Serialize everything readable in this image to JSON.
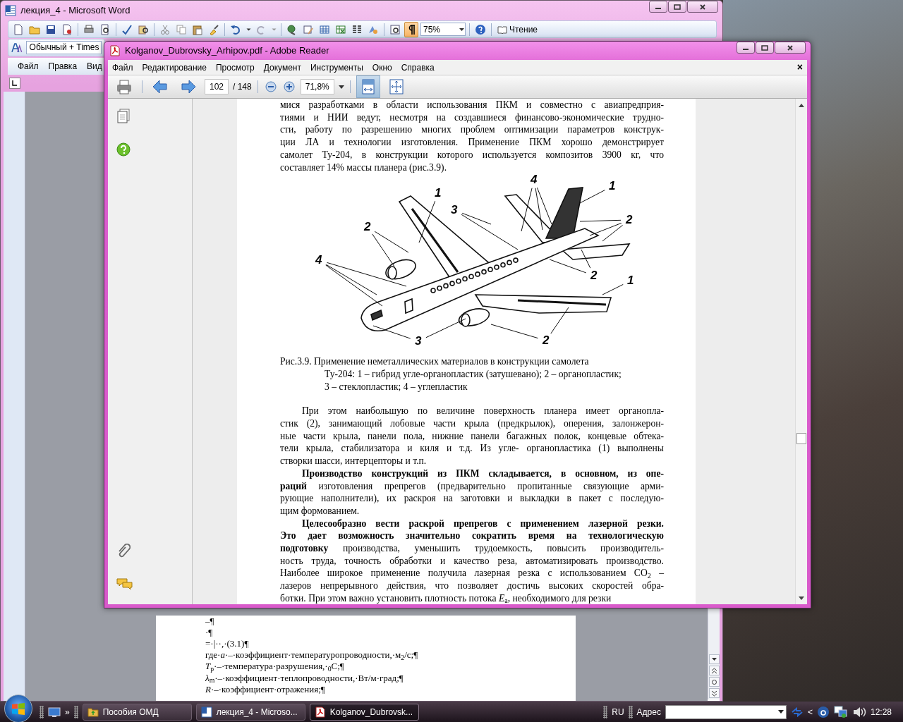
{
  "word_window": {
    "title": "лекция_4 - Microsoft Word",
    "zoom": "75%",
    "formatting_marks_on": true,
    "reading_button": "Чтение",
    "style_box": "Обычный + Times",
    "menu": [
      "Файл",
      "Правка",
      "Вид"
    ],
    "document_lines": [
      "–¶",
      "·¶",
      "=·|··,·(3.1)¶",
      "где·*a*·–·коэффициент·температуропроводности,·м$_{2}$/с;¶",
      "*T*$_{р}$·–·температура·разрушения,·$_{0}$С;¶",
      "*λ*$_{m}$·–·коэффициент·теплопроводности,·Вт/м·град;¶",
      "*R*·–·коэффициент·отражения;¶"
    ]
  },
  "reader_window": {
    "title": "Kolganov_Dubrovsky_Arhipov.pdf - Adobe Reader",
    "menu": [
      "Файл",
      "Редактирование",
      "Просмотр",
      "Документ",
      "Инструменты",
      "Окно",
      "Справка"
    ],
    "menu_close": "×",
    "page_number": "102",
    "page_total": "/ 148",
    "zoom": "71,8%",
    "view_tools": [
      {
        "kind": "fit-width",
        "selected": true
      },
      {
        "kind": "fit-page",
        "selected": false
      }
    ],
    "page": {
      "paragraphs_before": [
        {
          "kind": "continuation",
          "lines": [
            "мися разработками в области использования ПКМ и совместно с авиапредприя-",
            "тиями и НИИ ведут, несмотря на создавшиеся финансово-экономические трудно-",
            "сти, работу по разрешению многих проблем оптимизации параметров конструк-",
            "ции ЛА и технологии изготовления. Применение ПКМ хорошо демонстрирует",
            "самолет Ту-204, в конструкции которого используется композитов 3900 кг, что",
            "составляет 14% массы планера (рис.3.9)."
          ]
        }
      ],
      "figure": {
        "labels": [
          "4",
          "1",
          "3",
          "2",
          "4",
          "1",
          "2",
          "2",
          "1",
          "3",
          "2"
        ],
        "caption": [
          "Рис.3.9. Применение неметаллических материалов в конструкции самолета",
          "Ту-204: 1 – гибрид угле-органопластик (затушевано); 2 – органопластик;",
          "3 – стеклопластик; 4 – углепластик"
        ]
      },
      "paragraphs_after": [
        {
          "kind": "paragraph",
          "lines": [
            "При этом наибольшую по величине поверхность планера имеет органопла-",
            "стик (2), занимающий лобовые части крыла (предкрылок), оперения, залонжерон-",
            "ные части крыла, панели пола, нижние панели багажных полок, концевые обтека-",
            "тели крыла, стабилизатора и киля и т.д. Из угле- органопластика (1) выполнены",
            "створки шасси, интерцепторы и т.п."
          ]
        },
        {
          "kind": "paragraph",
          "lines": [
            "**Производство конструкций из ПКМ складывается, в основном, из опе-**",
            "**раций** изготовления препрегов (предварительно пропитанные связующие арми-",
            "рующие наполнители), их раскроя на заготовки и выкладки в пакет с последую-",
            "щим формованием."
          ]
        },
        {
          "kind": "paragraph",
          "lines": [
            "**Целесообразно вести раскрой препрегов с применением лазерной резки.**",
            "**Это дает возможность значительно сократить время на технологическую**",
            "**подготовку** производства, уменьшить трудоемкость, повысить производитель-",
            "ность труда, точность обработки и качество реза, автоматизировать производство.",
            "Наиболее широкое применение получила лазерная резка с использованием CO$_{2}$ –",
            "лазеров непрерывного действия, что позволяет достичь высоких скоростей обра-",
            "ботки. При этом важно установить плотность потока *E*$_{a}$, необходимого для резки"
          ]
        }
      ]
    }
  },
  "taskbar": {
    "quick_launch_more": "»",
    "tasks": [
      {
        "label": "Пособия ОМД",
        "kind": "folder",
        "selected": false
      },
      {
        "label": "лекция_4 - Microso...",
        "kind": "word",
        "selected": false
      },
      {
        "label": "Kolganov_Dubrovsk...",
        "kind": "pdf",
        "selected": true
      }
    ],
    "language": "RU",
    "address_label": "Адрес",
    "tray_more": "<",
    "clock": "12:28"
  }
}
